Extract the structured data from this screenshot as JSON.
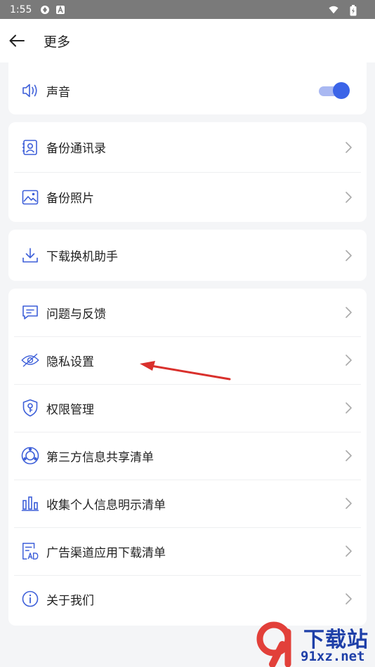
{
  "status_bar": {
    "time": "1:55",
    "icons_left": [
      "vpn-icon",
      "notification-a-icon"
    ],
    "icons_right": [
      "wifi-icon",
      "battery-icon"
    ]
  },
  "header": {
    "title": "更多",
    "back_icon": "arrow-left-icon"
  },
  "sections": [
    {
      "items": [
        {
          "label": "声音",
          "icon": "speaker-icon",
          "control": "toggle",
          "toggle_on": true
        }
      ]
    },
    {
      "items": [
        {
          "label": "备份通讯录",
          "icon": "contacts-icon"
        },
        {
          "label": "备份照片",
          "icon": "photo-icon"
        }
      ]
    },
    {
      "items": [
        {
          "label": "下载换机助手",
          "icon": "download-icon"
        }
      ]
    },
    {
      "items": [
        {
          "label": "问题与反馈",
          "icon": "feedback-icon"
        },
        {
          "label": "隐私设置",
          "icon": "eye-off-icon"
        },
        {
          "label": "权限管理",
          "icon": "shield-key-icon"
        },
        {
          "label": "第三方信息共享清单",
          "icon": "share-circle-icon"
        },
        {
          "label": "收集个人信息明示清单",
          "icon": "bar-chart-icon"
        },
        {
          "label": "广告渠道应用下载清单",
          "icon": "ad-list-icon"
        },
        {
          "label": "关于我们",
          "icon": "info-icon"
        }
      ]
    }
  ],
  "colors": {
    "accent": "#3b64e8",
    "icon_blue": "#3d5fd9",
    "background": "#f4f5f7",
    "arrow_red": "#d9302c"
  },
  "watermark": {
    "title": "下载站",
    "url": "91xz.net"
  }
}
